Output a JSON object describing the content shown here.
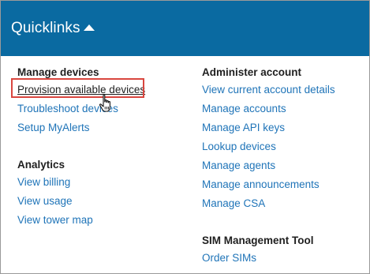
{
  "header": {
    "title": "Quicklinks",
    "caret_icon": "caret-up-icon",
    "background": "#0a6aa1"
  },
  "left_column": {
    "groups": [
      {
        "title": "Manage devices",
        "links": [
          "Provision available devices",
          "Troubleshoot devices",
          "Setup MyAlerts"
        ]
      },
      {
        "title": "Analytics",
        "links": [
          "View billing",
          "View usage",
          "View tower map"
        ]
      }
    ]
  },
  "right_column": {
    "groups": [
      {
        "title": "Administer account",
        "links": [
          "View current account details",
          "Manage accounts",
          "Manage API keys",
          "Lookup devices",
          "Manage agents",
          "Manage announcements",
          "Manage CSA"
        ]
      },
      {
        "title": "SIM Management Tool",
        "links": [
          "Order SIMs"
        ]
      }
    ]
  },
  "colors": {
    "link": "#1f74b8",
    "highlight_border": "#d9463f"
  },
  "cursor_icon": "hand-pointer-icon"
}
